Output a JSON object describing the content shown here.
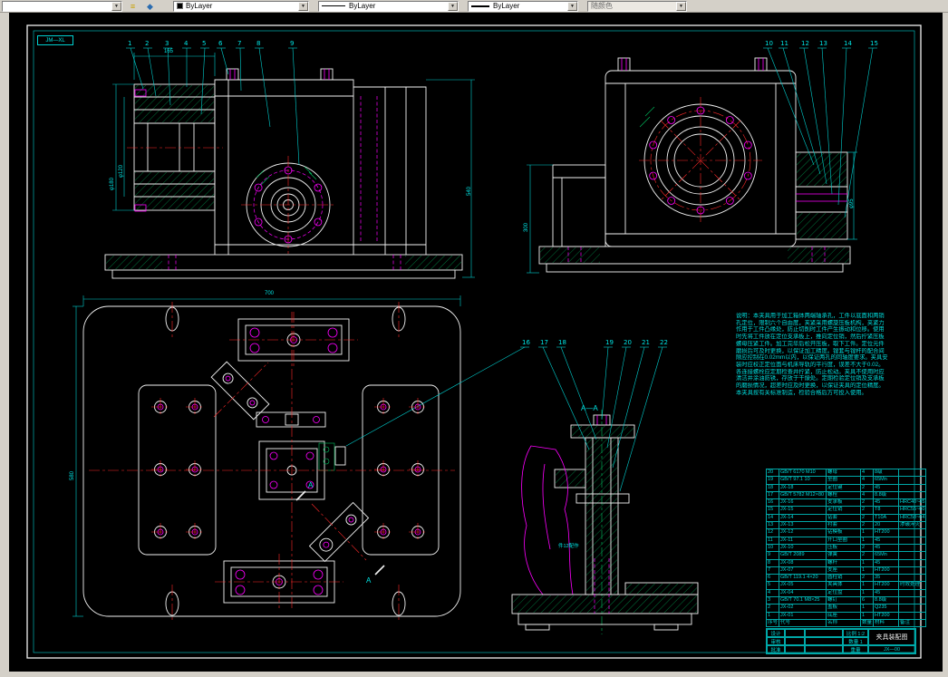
{
  "toolbar": {
    "icons": {
      "dropdown_arrow": "▼",
      "layer_properties": "≡",
      "set_layer_current": "◆"
    },
    "layer_control": {
      "value": ""
    },
    "color_control": {
      "value": "ByLayer"
    },
    "linetype_control": {
      "value": "ByLayer"
    },
    "lineweight_control": {
      "value": "ByLayer"
    },
    "plotstyle_control": {
      "value": "随颜色"
    }
  },
  "sheet": {
    "corner_label": "JM—XL"
  },
  "view_labels": {
    "section": "A—A",
    "arrow": "A"
  },
  "balloons": [
    "1",
    "2",
    "3",
    "4",
    "5",
    "6",
    "7",
    "8",
    "9",
    "10",
    "11",
    "12",
    "13",
    "14",
    "15",
    "16",
    "17",
    "18",
    "19",
    "20",
    "21",
    "22"
  ],
  "dimensions": {
    "front_left_outer": "φ180",
    "front_left_inner": "φ120",
    "front_right": "540",
    "front_top": "165",
    "side_left": "300",
    "side_right": "φ95",
    "plan_top": "700",
    "plan_left": "580"
  },
  "small_notes": [
    "件12配作"
  ],
  "notes": {
    "lines": [
      "说明：本夹具用于加工箱体两端轴承孔，工件以底面和两销",
      "孔定位，限制六个自由度，夹紧采用螺旋压板机构，夹紧力",
      "作用于工件凸缘处，防止切削时工件产生振动和位移。使用",
      "时先将工件放在定位支承板上，推向定位销，然后拧紧压板",
      "螺母压紧工件。加工完毕后松开压板，取下工件。定位元件",
      "磨损后可及时更换，以保证加工精度。镗套与镗杆的配合间",
      "隙应控制在0.02mm以内，以保证两孔的同轴度要求。夹具安",
      "装时应校正定位面与机床导轨的平行度，误差不大于0.02。",
      "各连接螺栓应定期检查并拧紧，防止松动。夹具不使用时应",
      "清洁并涂油防锈，存放于干燥处。定期检验定位销及支承板",
      "的磨损情况，超差时应及时更换，以保证夹具的定位精度。",
      "本夹具按有关标准制造，检验合格后方可投入使用。"
    ]
  },
  "bom": {
    "columns": [
      "序号",
      "代号",
      "名称",
      "数量",
      "材料",
      "备注"
    ],
    "rows": [
      [
        "20",
        "GB/T 6170 M10",
        "螺母",
        "4",
        "8级",
        ""
      ],
      [
        "19",
        "GB/T 97.1 10",
        "垫圈",
        "4",
        "65Mn",
        ""
      ],
      [
        "18",
        "JX-18",
        "定位键",
        "2",
        "45",
        ""
      ],
      [
        "17",
        "GB/T 5782 M12×80",
        "螺栓",
        "4",
        "8.8级",
        ""
      ],
      [
        "16",
        "JX-16",
        "支承板",
        "2",
        "45",
        "HRC40~45"
      ],
      [
        "15",
        "JX-15",
        "定位销",
        "2",
        "T8",
        "HRC55~60"
      ],
      [
        "14",
        "JX-14",
        "钻套",
        "2",
        "T10A",
        "HRC58~64"
      ],
      [
        "13",
        "JX-13",
        "衬套",
        "2",
        "20",
        "渗碳淬火"
      ],
      [
        "12",
        "JX-12",
        "钻模板",
        "1",
        "HT200",
        ""
      ],
      [
        "11",
        "JX-11",
        "开口垫圈",
        "1",
        "45",
        ""
      ],
      [
        "10",
        "JX-10",
        "压板",
        "2",
        "45",
        ""
      ],
      [
        "9",
        "GB/T 2089",
        "弹簧",
        "2",
        "65Mn",
        ""
      ],
      [
        "8",
        "JX-08",
        "螺杆",
        "1",
        "45",
        ""
      ],
      [
        "7",
        "JX-07",
        "支座",
        "1",
        "HT200",
        ""
      ],
      [
        "6",
        "GB/T 119.1 4×20",
        "圆柱销",
        "2",
        "35",
        ""
      ],
      [
        "5",
        "JX-05",
        "夹具体",
        "1",
        "HT200",
        "时效处理"
      ],
      [
        "4",
        "JX-04",
        "定位盘",
        "1",
        "45",
        ""
      ],
      [
        "3",
        "GB/T 70.1 M8×25",
        "螺钉",
        "6",
        "8.8级",
        ""
      ],
      [
        "2",
        "JX-02",
        "盖板",
        "1",
        "Q235",
        ""
      ],
      [
        "1",
        "JX-01",
        "底座",
        "1",
        "HT200",
        ""
      ]
    ]
  },
  "title_block": {
    "designer_label": "设计",
    "checker_label": "审核",
    "approver_label": "批准",
    "scale": "比例 1:2",
    "qty": "数量 1",
    "weight": "重量",
    "title": "夹具装配图",
    "drawing_no": "JX—00"
  },
  "colors": {
    "background": "#000000",
    "outline_white": "#f2f2f2",
    "dimension_cyan": "#00e5e5",
    "detail_magenta": "#ff00ff",
    "centerline_red": "#ff2a2a",
    "hatch_green": "#00c060",
    "chrome_gray": "#d4d0c8"
  }
}
